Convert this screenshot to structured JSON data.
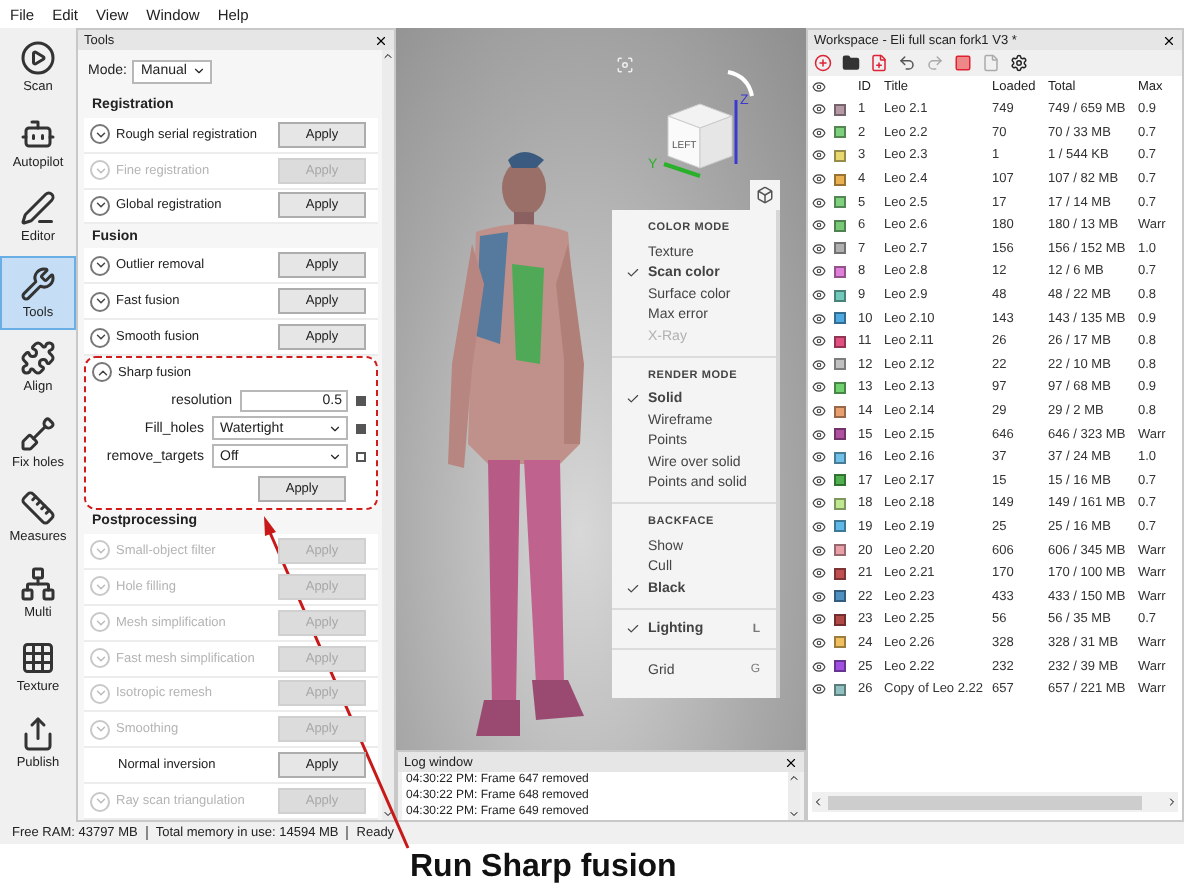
{
  "menu_bar": [
    "File",
    "Edit",
    "View",
    "Window",
    "Help"
  ],
  "sidebar": [
    {
      "label": "Scan",
      "selected": false
    },
    {
      "label": "Autopilot",
      "selected": false
    },
    {
      "label": "Editor",
      "selected": false
    },
    {
      "label": "Tools",
      "selected": true
    },
    {
      "label": "Align",
      "selected": false
    },
    {
      "label": "Fix holes",
      "selected": false
    },
    {
      "label": "Measures",
      "selected": false
    },
    {
      "label": "Multi",
      "selected": false
    },
    {
      "label": "Texture",
      "selected": false
    },
    {
      "label": "Publish",
      "selected": false
    }
  ],
  "tools_panel": {
    "title": "Tools",
    "mode": {
      "label": "Mode:",
      "value": "Manual"
    },
    "sections": [
      {
        "title": "Registration",
        "rows": [
          {
            "kind": "tool",
            "label": "Rough serial registration",
            "button": "Apply",
            "disabled": false,
            "expanded": false
          },
          {
            "kind": "tool",
            "label": "Fine registration",
            "button": "Apply",
            "disabled": true,
            "expanded": false
          },
          {
            "kind": "tool",
            "label": "Global registration",
            "button": "Apply",
            "disabled": false,
            "expanded": false
          }
        ]
      },
      {
        "title": "Fusion",
        "rows": [
          {
            "kind": "tool",
            "label": "Outlier removal",
            "button": "Apply",
            "disabled": false,
            "expanded": false
          },
          {
            "kind": "tool",
            "label": "Fast fusion",
            "button": "Apply",
            "disabled": false,
            "expanded": false
          },
          {
            "kind": "tool",
            "label": "Smooth fusion",
            "button": "Apply",
            "disabled": false,
            "expanded": false
          },
          {
            "kind": "tool",
            "label": "Sharp fusion",
            "button": "Apply",
            "disabled": false,
            "expanded": true,
            "annotated": true,
            "params": [
              {
                "kind": "input",
                "label": "resolution",
                "value": "0.5",
                "checked": true
              },
              {
                "kind": "select",
                "label": "Fill_holes",
                "value": "Watertight",
                "checked": true
              },
              {
                "kind": "select",
                "label": "remove_targets",
                "value": "Off",
                "checked": false
              }
            ]
          }
        ]
      },
      {
        "title": "Postprocessing",
        "rows": [
          {
            "kind": "tool",
            "label": "Small-object filter",
            "button": "Apply",
            "disabled": true,
            "expanded": false
          },
          {
            "kind": "tool",
            "label": "Hole filling",
            "button": "Apply",
            "disabled": true,
            "expanded": false
          },
          {
            "kind": "tool",
            "label": "Mesh simplification",
            "button": "Apply",
            "disabled": true,
            "expanded": false
          },
          {
            "kind": "tool",
            "label": "Fast mesh simplification",
            "button": "Apply",
            "disabled": true,
            "expanded": false
          },
          {
            "kind": "tool",
            "label": "Isotropic remesh",
            "button": "Apply",
            "disabled": true,
            "expanded": false
          },
          {
            "kind": "tool",
            "label": "Smoothing",
            "button": "Apply",
            "disabled": true,
            "expanded": false
          },
          {
            "kind": "plain",
            "label": "Normal inversion",
            "button": "Apply",
            "disabled": false,
            "expanded": false
          },
          {
            "kind": "tool",
            "label": "Ray scan triangulation",
            "button": "Apply",
            "disabled": true,
            "expanded": false
          }
        ]
      }
    ]
  },
  "viewport": {
    "nav_cube": {
      "face": "LEFT",
      "axes": [
        "Z",
        "Y"
      ]
    },
    "display_menu": {
      "sections": [
        {
          "title": "COLOR MODE",
          "items": [
            {
              "label": "Texture",
              "checked": false,
              "disabled": false
            },
            {
              "label": "Scan color",
              "checked": true,
              "disabled": false
            },
            {
              "label": "Surface color",
              "checked": false,
              "disabled": false
            },
            {
              "label": "Max error",
              "checked": false,
              "disabled": false
            },
            {
              "label": "X-Ray",
              "checked": false,
              "disabled": true
            }
          ]
        },
        {
          "title": "RENDER MODE",
          "items": [
            {
              "label": "Solid",
              "checked": true,
              "disabled": false
            },
            {
              "label": "Wireframe",
              "checked": false,
              "disabled": false
            },
            {
              "label": "Points",
              "checked": false,
              "disabled": false
            },
            {
              "label": "Wire over solid",
              "checked": false,
              "disabled": false
            },
            {
              "label": "Points and solid",
              "checked": false,
              "disabled": false
            }
          ]
        },
        {
          "title": "BACKFACE",
          "items": [
            {
              "label": "Show",
              "checked": false,
              "disabled": false
            },
            {
              "label": "Cull",
              "checked": false,
              "disabled": false
            },
            {
              "label": "Black",
              "checked": true,
              "disabled": false
            }
          ]
        },
        {
          "items": [
            {
              "label": "Lighting",
              "checked": true,
              "disabled": false,
              "shortcut": "L"
            }
          ]
        },
        {
          "items": [
            {
              "label": "Grid",
              "checked": false,
              "disabled": false,
              "shortcut": "G"
            }
          ]
        }
      ]
    }
  },
  "log_window": {
    "title": "Log window",
    "lines": [
      "04:30:22 PM: Frame 647 removed",
      "04:30:22 PM: Frame 648 removed",
      "04:30:22 PM: Frame 649 removed"
    ]
  },
  "workspace": {
    "title": "Workspace - Eli full scan fork1 V3 *",
    "columns": [
      "ID",
      "Title",
      "Loaded",
      "Total",
      "Max"
    ],
    "rows": [
      {
        "id": "1",
        "title": "Leo 2.1",
        "loaded": "749",
        "total": "749 / 659 MB",
        "max": "0.9",
        "color": "#b59aa6",
        "visible": true
      },
      {
        "id": "2",
        "title": "Leo 2.2",
        "loaded": "70",
        "total": "70 / 33 MB",
        "max": "0.7",
        "color": "#7ed07e",
        "visible": true
      },
      {
        "id": "3",
        "title": "Leo 2.3",
        "loaded": "1",
        "total": "1 / 544 KB",
        "max": "0.7",
        "color": "#e8d870",
        "visible": true
      },
      {
        "id": "4",
        "title": "Leo 2.4",
        "loaded": "107",
        "total": "107 / 82 MB",
        "max": "0.7",
        "color": "#e8b050",
        "visible": true
      },
      {
        "id": "5",
        "title": "Leo 2.5",
        "loaded": "17",
        "total": "17 / 14 MB",
        "max": "0.7",
        "color": "#80d080",
        "visible": true
      },
      {
        "id": "6",
        "title": "Leo 2.6",
        "loaded": "180",
        "total": "180 / 13 MB",
        "max": "Warr",
        "color": "#78c878",
        "visible": true
      },
      {
        "id": "7",
        "title": "Leo 2.7",
        "loaded": "156",
        "total": "156 / 152 MB",
        "max": "1.0",
        "color": "#b0b0b0",
        "visible": true
      },
      {
        "id": "8",
        "title": "Leo 2.8",
        "loaded": "12",
        "total": "12 / 6 MB",
        "max": "0.7",
        "color": "#e080d8",
        "visible": true
      },
      {
        "id": "9",
        "title": "Leo 2.9",
        "loaded": "48",
        "total": "48 / 22 MB",
        "max": "0.8",
        "color": "#70c8b8",
        "visible": true
      },
      {
        "id": "10",
        "title": "Leo 2.10",
        "loaded": "143",
        "total": "143 / 135 MB",
        "max": "0.9",
        "color": "#50a8e0",
        "visible": true
      },
      {
        "id": "11",
        "title": "Leo 2.11",
        "loaded": "26",
        "total": "26 / 17 MB",
        "max": "0.8",
        "color": "#e05080",
        "visible": true
      },
      {
        "id": "12",
        "title": "Leo 2.12",
        "loaded": "22",
        "total": "22 / 10 MB",
        "max": "0.8",
        "color": "#c0c0c0",
        "visible": true
      },
      {
        "id": "13",
        "title": "Leo 2.13",
        "loaded": "97",
        "total": "97 / 68 MB",
        "max": "0.9",
        "color": "#70d070",
        "visible": true
      },
      {
        "id": "14",
        "title": "Leo 2.14",
        "loaded": "29",
        "total": "29 / 2 MB",
        "max": "0.8",
        "color": "#e8a070",
        "visible": true
      },
      {
        "id": "15",
        "title": "Leo 2.15",
        "loaded": "646",
        "total": "646 / 323 MB",
        "max": "Warr",
        "color": "#b050a0",
        "visible": true
      },
      {
        "id": "16",
        "title": "Leo 2.16",
        "loaded": "37",
        "total": "37 / 24 MB",
        "max": "1.0",
        "color": "#70c0e8",
        "visible": true
      },
      {
        "id": "17",
        "title": "Leo 2.17",
        "loaded": "15",
        "total": "15 / 16 MB",
        "max": "0.7",
        "color": "#50b050",
        "visible": true
      },
      {
        "id": "18",
        "title": "Leo 2.18",
        "loaded": "149",
        "total": "149 / 161 MB",
        "max": "0.7",
        "color": "#c0e890",
        "visible": true
      },
      {
        "id": "19",
        "title": "Leo 2.19",
        "loaded": "25",
        "total": "25 / 16 MB",
        "max": "0.7",
        "color": "#60b8e8",
        "visible": true
      },
      {
        "id": "20",
        "title": "Leo 2.20",
        "loaded": "606",
        "total": "606 / 345 MB",
        "max": "Warr",
        "color": "#e8a0a8",
        "visible": true
      },
      {
        "id": "21",
        "title": "Leo 2.21",
        "loaded": "170",
        "total": "170 / 100 MB",
        "max": "Warr",
        "color": "#c05050",
        "visible": true
      },
      {
        "id": "22",
        "title": "Leo 2.23",
        "loaded": "433",
        "total": "433 / 150 MB",
        "max": "Warr",
        "color": "#5090c0",
        "visible": true
      },
      {
        "id": "23",
        "title": "Leo 2.25",
        "loaded": "56",
        "total": "56 / 35 MB",
        "max": "0.7",
        "color": "#b04848",
        "visible": true
      },
      {
        "id": "24",
        "title": "Leo 2.26",
        "loaded": "328",
        "total": "328 / 31 MB",
        "max": "Warr",
        "color": "#f0c060",
        "visible": true
      },
      {
        "id": "25",
        "title": "Leo 2.22",
        "loaded": "232",
        "total": "232 / 39 MB",
        "max": "Warr",
        "color": "#a050e0",
        "visible": true
      },
      {
        "id": "26",
        "title": "Copy of Leo 2.22",
        "loaded": "657",
        "total": "657 / 221 MB",
        "max": "Warr",
        "color": "#90c0c0",
        "visible": true
      }
    ]
  },
  "status_bar": [
    "Free RAM: 43797 MB",
    "Total memory in use: 14594 MB",
    "Ready"
  ],
  "annotation": {
    "caption": "Run Sharp fusion"
  }
}
